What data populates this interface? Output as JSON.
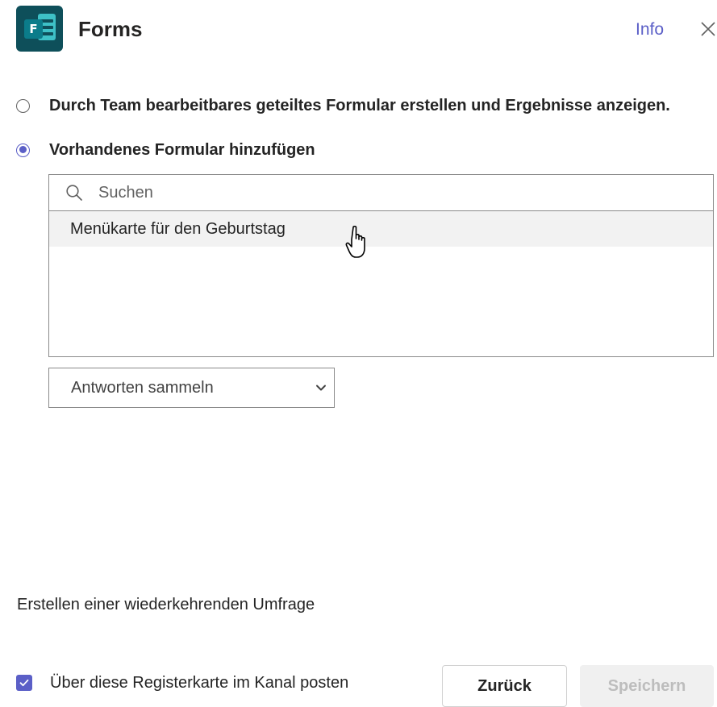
{
  "header": {
    "app_icon": "forms-app-icon",
    "app_icon_letter": "F",
    "title": "Forms",
    "info_label": "Info",
    "close_icon": "close-icon"
  },
  "options": [
    {
      "label": "Durch Team bearbeitbares geteiltes Formular erstellen und Ergebnisse anzeigen.",
      "selected": false
    },
    {
      "label": "Vorhandenes Formular hinzufügen",
      "selected": true
    }
  ],
  "search": {
    "icon": "search-icon",
    "placeholder": "Suchen",
    "value": "",
    "results": [
      "Menükarte für den Geburtstag"
    ]
  },
  "mode_select": {
    "value": "Antworten sammeln",
    "icon": "chevron-down-icon"
  },
  "recurring_label": "Erstellen einer wiederkehrenden Umfrage",
  "post_checkbox": {
    "label": "Über diese Registerkarte im Kanal posten",
    "checked": true
  },
  "buttons": {
    "back": "Zurück",
    "save": "Speichern"
  },
  "colors": {
    "accent": "#5b5fc7",
    "forms_icon_bg": "#0e4f5a",
    "forms_icon_teal": "#3ec1c7",
    "hover_row": "#f2f2f2",
    "disabled_button_bg": "#f0f0f0"
  }
}
